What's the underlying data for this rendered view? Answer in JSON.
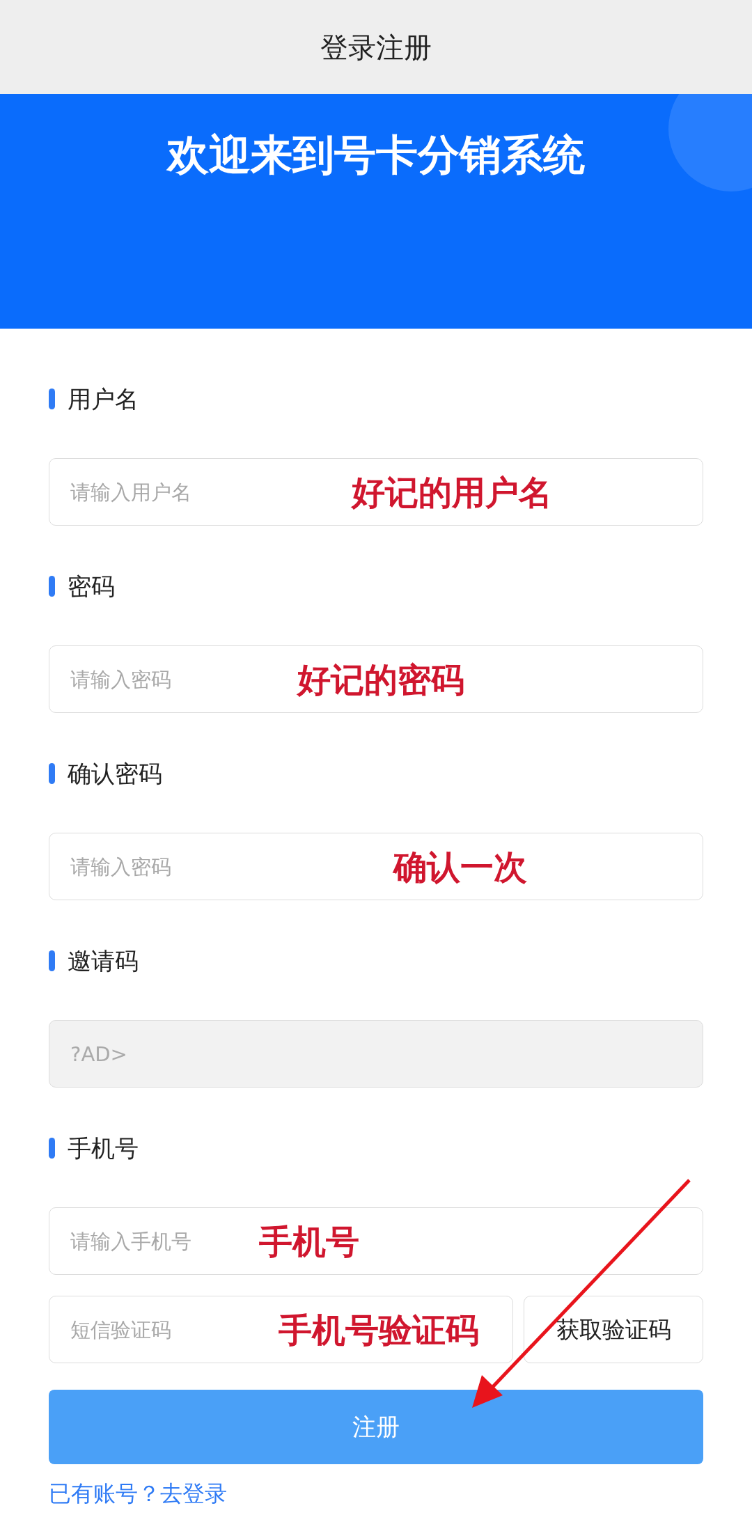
{
  "header": {
    "title": "登录注册"
  },
  "hero": {
    "title": "欢迎来到号卡分销系统"
  },
  "fields": [
    {
      "label": "用户名",
      "placeholder": "请输入用户名",
      "disabled": false,
      "note": "好记的用户名"
    },
    {
      "label": "密码",
      "placeholder": "请输入密码",
      "disabled": false,
      "note": "好记的密码"
    },
    {
      "label": "确认密码",
      "placeholder": "请输入密码",
      "disabled": false,
      "note": "确认一次"
    },
    {
      "label": "邀请码",
      "value": "?AD>",
      "disabled": true
    },
    {
      "label": "手机号",
      "placeholder": "请输入手机号",
      "disabled": false,
      "note": "手机号"
    }
  ],
  "sms": {
    "placeholder": "短信验证码",
    "note": "手机号验证码",
    "button": "获取验证码"
  },
  "submit": "注册",
  "login_link": "已有账号？去登录"
}
